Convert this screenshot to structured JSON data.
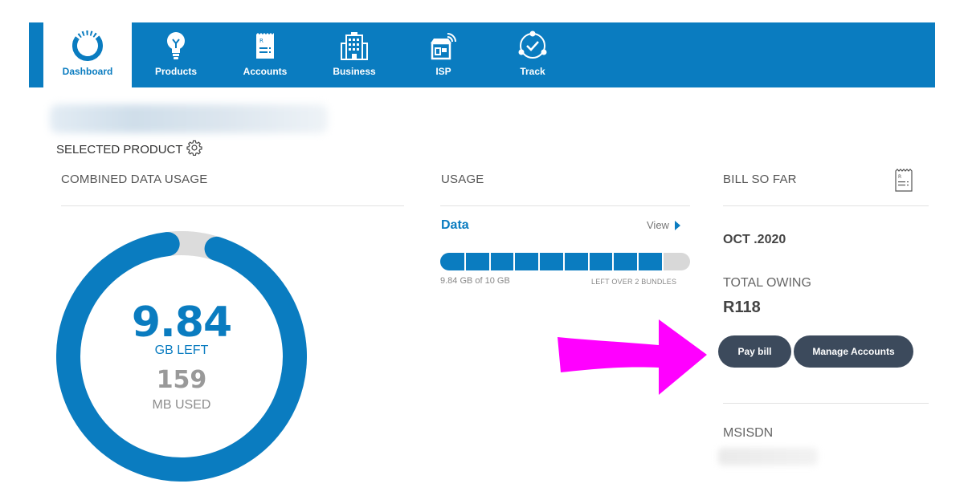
{
  "nav": {
    "items": [
      {
        "label": "Dashboard",
        "icon": "dashboard-ring-icon",
        "active": true
      },
      {
        "label": "Products",
        "icon": "lightbulb-icon"
      },
      {
        "label": "Accounts",
        "icon": "invoice-icon"
      },
      {
        "label": "Business",
        "icon": "office-building-icon"
      },
      {
        "label": "ISP",
        "icon": "wifi-store-icon"
      },
      {
        "label": "Track",
        "icon": "track-check-icon"
      }
    ]
  },
  "header": {
    "selected_product_label": "SELECTED PRODUCT"
  },
  "combined": {
    "title": "COMBINED DATA USAGE",
    "left_value": "9.84",
    "left_unit": "GB LEFT",
    "used_value": "159",
    "used_unit": "MB USED",
    "fraction_left": 0.984
  },
  "usage": {
    "title": "USAGE",
    "item_label": "Data",
    "view_label": "View",
    "fraction_left": 0.89,
    "segments": 9,
    "caption": "9.84 GB of 10 GB",
    "caption_right": "LEFT OVER 2 BUNDLES"
  },
  "bill": {
    "title": "BILL SO FAR",
    "month": "OCT .2020",
    "total_label": "TOTAL OWING",
    "total_amount": "R118",
    "pay_button": "Pay bill",
    "manage_button": "Manage Accounts",
    "msisdn_label": "MSISDN"
  },
  "colors": {
    "primary": "#0a7cc0",
    "button": "#3c4a5c",
    "arrow": "#ff00ff"
  }
}
